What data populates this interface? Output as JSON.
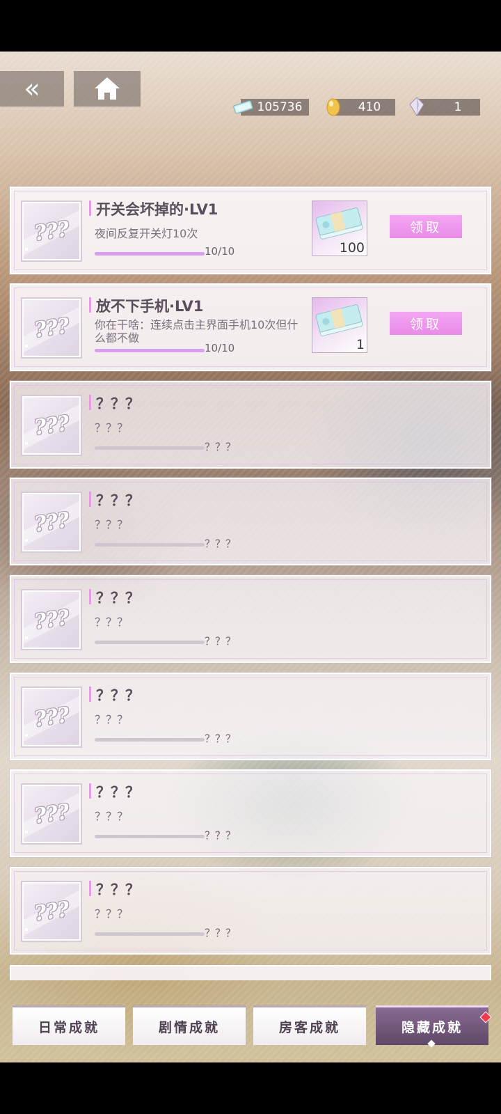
{
  "header": {
    "back_label": "«",
    "currencies": [
      {
        "icon": "cash-icon",
        "value": "105736"
      },
      {
        "icon": "gold-egg-icon",
        "value": "410"
      },
      {
        "icon": "crystal-icon",
        "value": "1"
      }
    ]
  },
  "achievements": [
    {
      "badge": "???",
      "title": "开关会坏掉的·LV1",
      "desc": "夜间反复开关灯10次",
      "progress_text": "10/10",
      "progress": 1.0,
      "reward_icon": "cash-bundle-icon",
      "reward_count": "100",
      "claim_label": "领取"
    },
    {
      "badge": "???",
      "title": "放不下手机·LV1",
      "desc": "你在干啥：连续点击主界面手机10次但什么都不做",
      "progress_text": "10/10",
      "progress": 1.0,
      "reward_icon": "cash-bundle-icon",
      "reward_count": "1",
      "claim_label": "领取"
    },
    {
      "badge": "???",
      "title": "？？？",
      "desc": "？？？",
      "progress_text": "？？？",
      "progress": 0
    },
    {
      "badge": "???",
      "title": "？？？",
      "desc": "？？？",
      "progress_text": "？？？",
      "progress": 0
    },
    {
      "badge": "???",
      "title": "？？？",
      "desc": "？？？",
      "progress_text": "？？？",
      "progress": 0
    },
    {
      "badge": "???",
      "title": "？？？",
      "desc": "？？？",
      "progress_text": "？？？",
      "progress": 0
    },
    {
      "badge": "???",
      "title": "？？？",
      "desc": "？？？",
      "progress_text": "？？？",
      "progress": 0
    },
    {
      "badge": "???",
      "title": "？？？",
      "desc": "？？？",
      "progress_text": "？？？",
      "progress": 0
    }
  ],
  "tabs": [
    {
      "label": "日常成就",
      "active": false
    },
    {
      "label": "剧情成就",
      "active": false
    },
    {
      "label": "房客成就",
      "active": false
    },
    {
      "label": "隐藏成就",
      "active": true
    }
  ],
  "colors": {
    "accent_pink": "#e98be9",
    "progress_fill": "#d89ff1",
    "tab_active": "#6e547a",
    "notification_red": "#f0394f"
  }
}
